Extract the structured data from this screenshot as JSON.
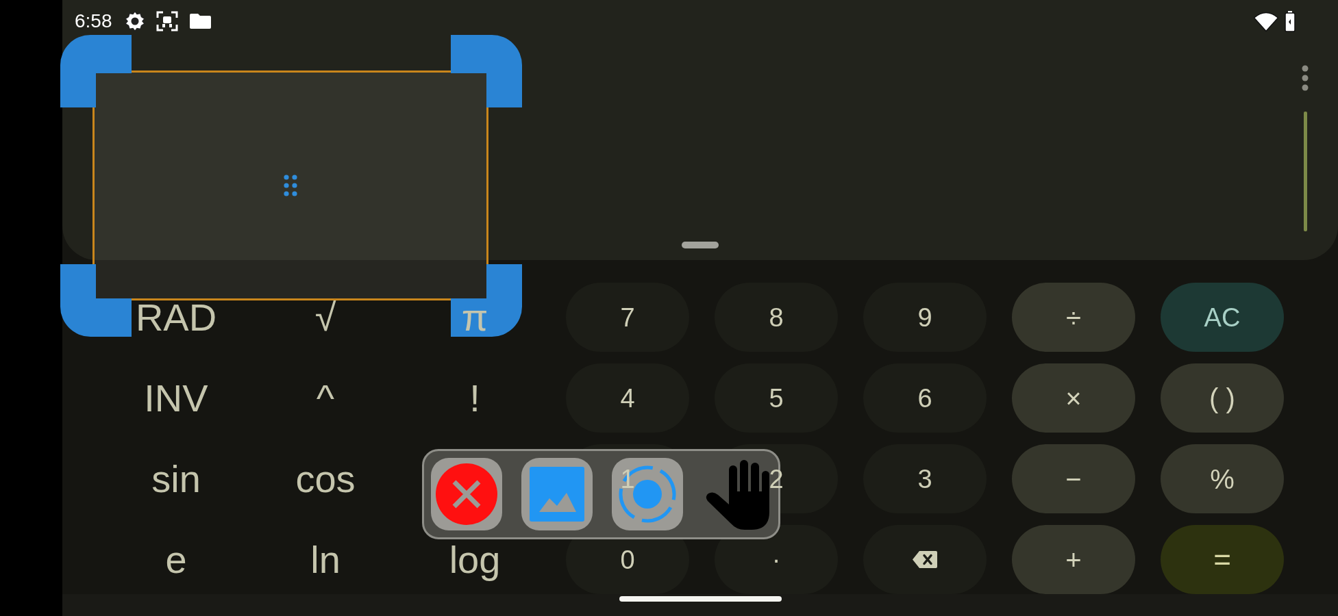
{
  "status_bar": {
    "time": "6:58"
  },
  "scientific_keys": [
    [
      "RAD",
      "√",
      "π"
    ],
    [
      "INV",
      "^",
      "!"
    ],
    [
      "sin",
      "cos"
    ],
    [
      "e",
      "ln",
      "log"
    ]
  ],
  "keys": [
    {
      "label": "7",
      "kind": "digit"
    },
    {
      "label": "8",
      "kind": "digit"
    },
    {
      "label": "9",
      "kind": "digit"
    },
    {
      "label": "÷",
      "kind": "operator"
    },
    {
      "label": "AC",
      "kind": "clear"
    },
    {
      "label": "4",
      "kind": "digit"
    },
    {
      "label": "5",
      "kind": "digit"
    },
    {
      "label": "6",
      "kind": "digit"
    },
    {
      "label": "×",
      "kind": "operator"
    },
    {
      "label": "( )",
      "kind": "operator"
    },
    {
      "label": "1",
      "kind": "digit"
    },
    {
      "label": "2",
      "kind": "digit"
    },
    {
      "label": "3",
      "kind": "digit"
    },
    {
      "label": "−",
      "kind": "operator"
    },
    {
      "label": "%",
      "kind": "operator"
    },
    {
      "label": "0",
      "kind": "digit"
    },
    {
      "label": "·",
      "kind": "digit"
    },
    {
      "kind": "backspace"
    },
    {
      "label": "+",
      "kind": "operator"
    },
    {
      "label": "=",
      "kind": "equals"
    }
  ]
}
